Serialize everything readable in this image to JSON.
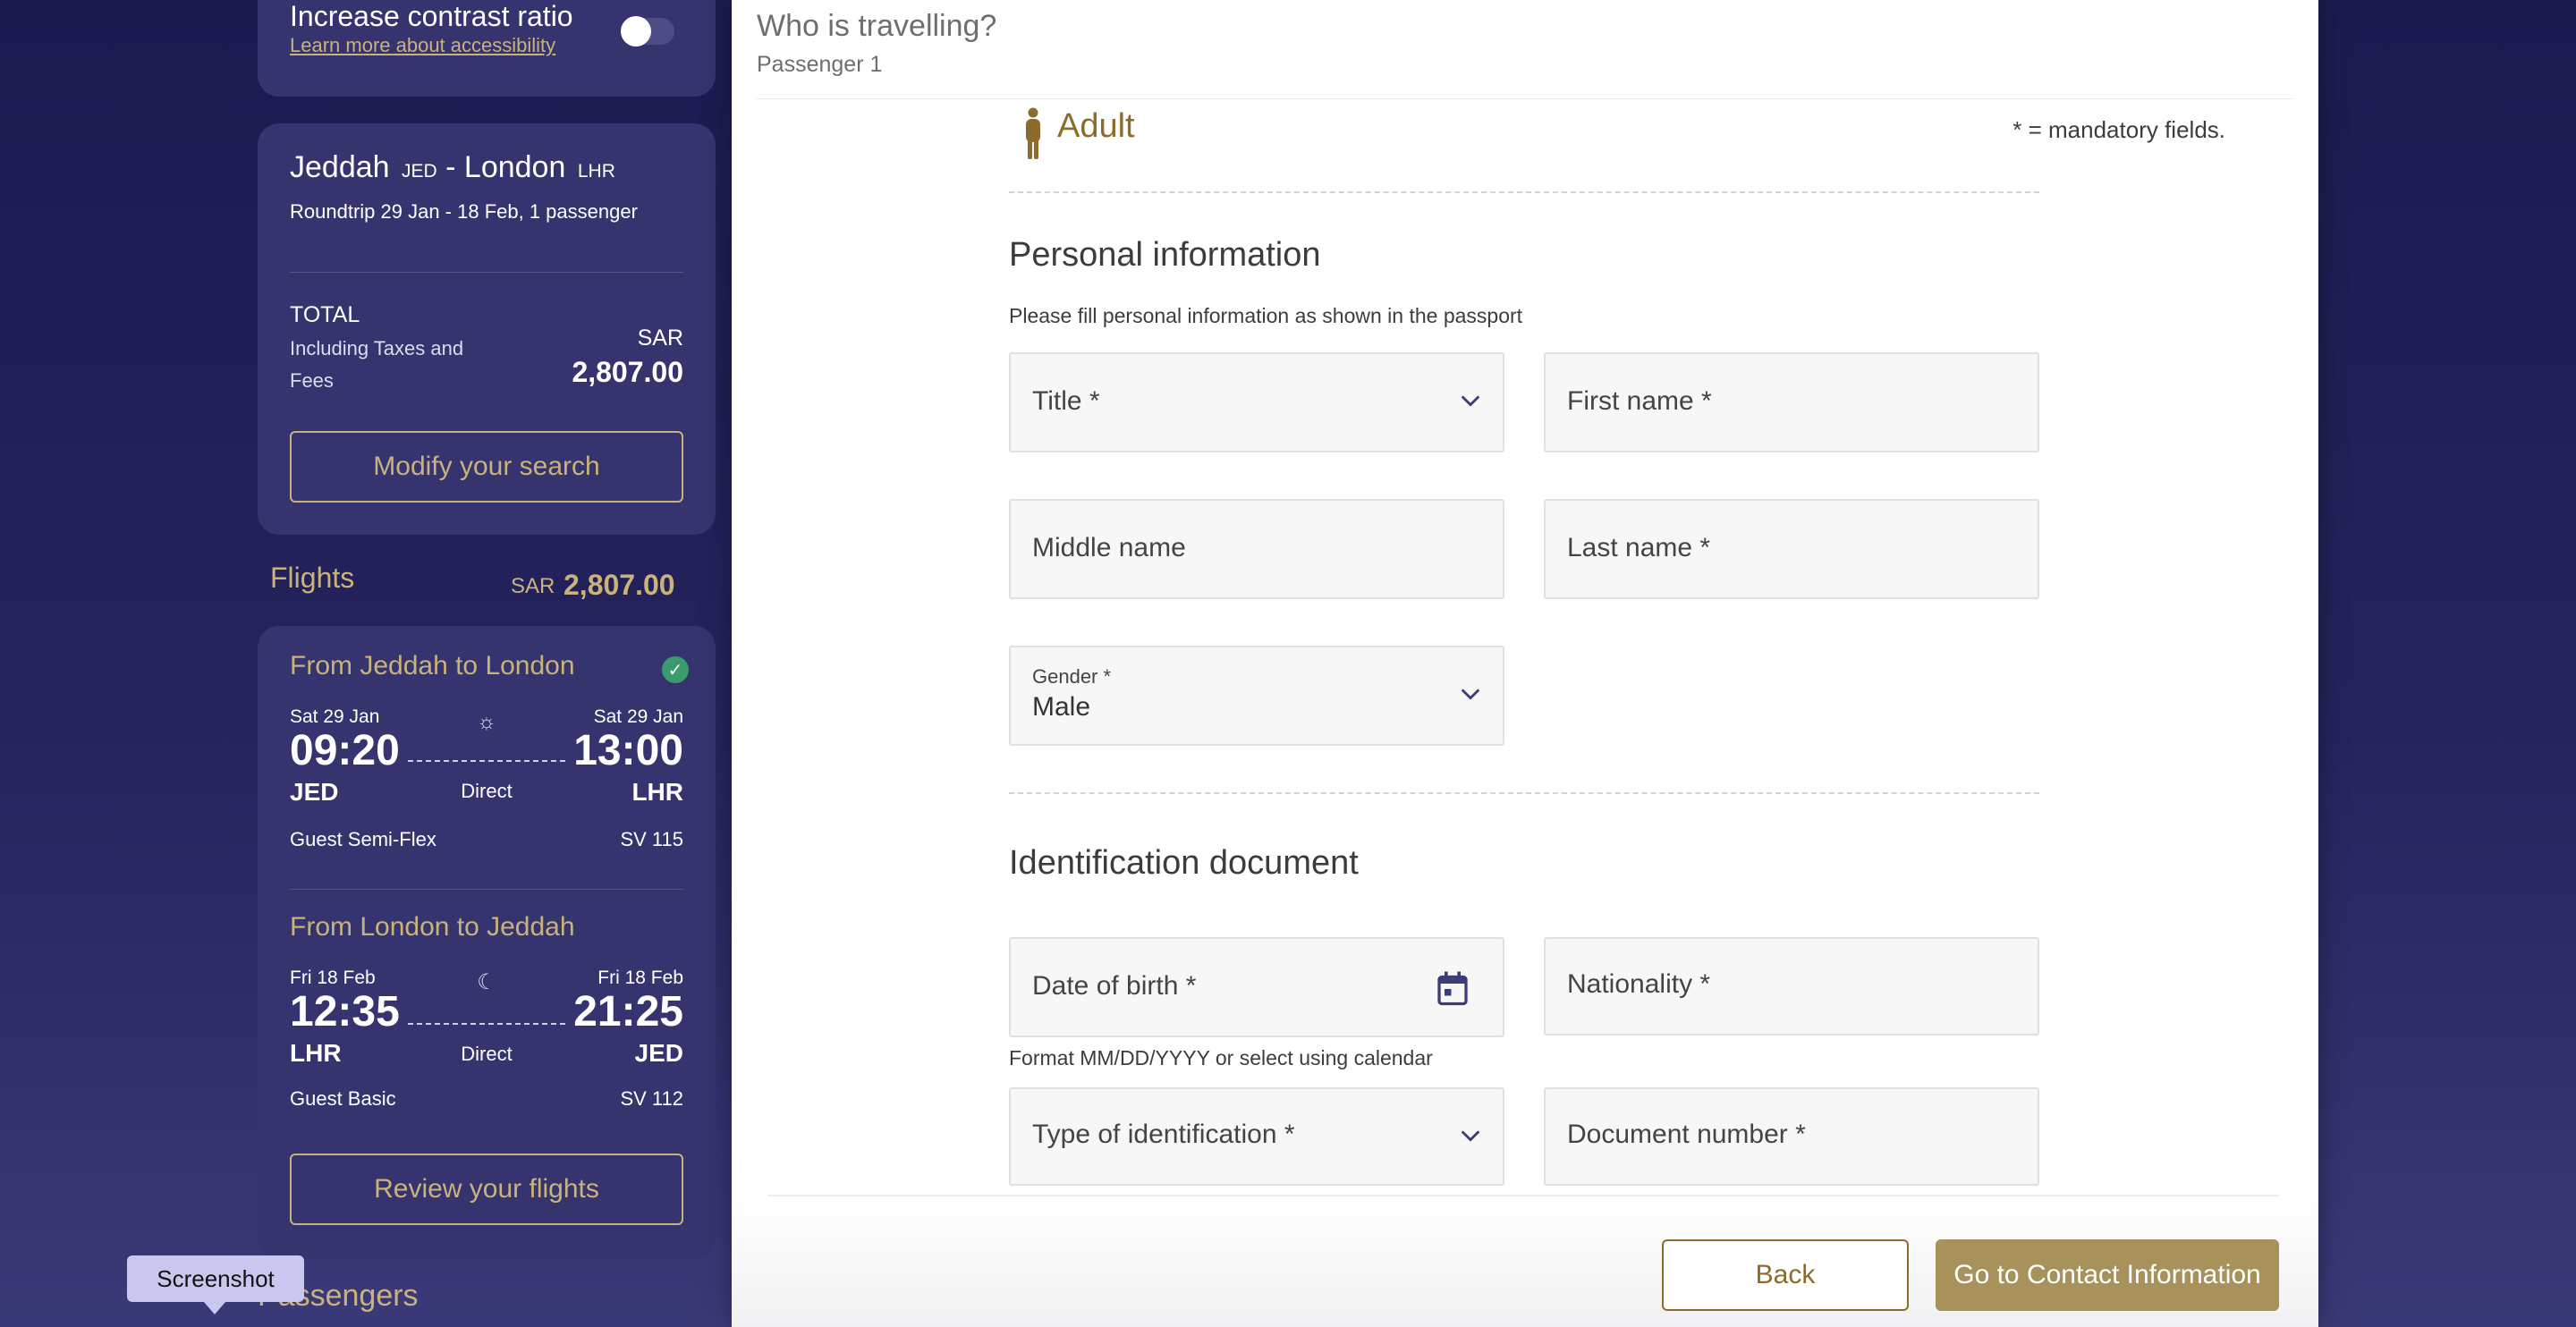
{
  "accessibility": {
    "title": "Increase contrast ratio",
    "link": "Learn more about accessibility",
    "toggle_on": false
  },
  "summary": {
    "origin_city": "Jeddah",
    "origin_code": "JED",
    "separator": "-",
    "destination_city": "London",
    "destination_code": "LHR",
    "trip_info": "Roundtrip 29 Jan - 18 Feb, 1 passenger",
    "total_label": "TOTAL",
    "total_note": "Including Taxes and Fees",
    "currency": "SAR",
    "total_amount": "2,807.00",
    "modify_button": "Modify your search"
  },
  "flights": {
    "heading": "Flights",
    "currency": "SAR",
    "price": "2,807.00",
    "legs": [
      {
        "title": "From Jeddah to London",
        "status_icon": "check-circle-icon",
        "dep_date": "Sat 29 Jan",
        "dep_time": "09:20",
        "dep_airport": "JED",
        "arr_date": "Sat 29 Jan",
        "arr_time": "13:00",
        "arr_airport": "LHR",
        "stops": "Direct",
        "time_icon": "sun-icon",
        "fare": "Guest Semi-Flex",
        "flight_no": "SV 115"
      },
      {
        "title": "From London to Jeddah",
        "dep_date": "Fri 18 Feb",
        "dep_time": "12:35",
        "dep_airport": "LHR",
        "arr_date": "Fri 18 Feb",
        "arr_time": "21:25",
        "arr_airport": "JED",
        "stops": "Direct",
        "time_icon": "sun-moon-icon",
        "fare": "Guest Basic",
        "flight_no": "SV 112"
      }
    ],
    "review_button": "Review your flights"
  },
  "passengers_heading": "Passengers",
  "tooltip": "Screenshot",
  "form": {
    "title": "Who is travelling?",
    "subtitle": "Passenger 1",
    "passenger_type": "Adult",
    "mandatory_note": "* = mandatory fields.",
    "personal": {
      "heading": "Personal information",
      "note": "Please fill personal information as shown in the passport",
      "title_label": "Title *",
      "first_name_label": "First name *",
      "middle_name_label": "Middle name",
      "last_name_label": "Last name *",
      "gender_label": "Gender *",
      "gender_value": "Male"
    },
    "identification": {
      "heading": "Identification document",
      "dob_label": "Date of birth *",
      "nationality_label": "Nationality *",
      "date_hint": "Format MM/DD/YYYY or select using calendar",
      "id_type_label": "Type of identification *",
      "document_number_label": "Document number *"
    },
    "back_button": "Back",
    "next_button": "Go to Contact Information"
  },
  "colors": {
    "accent_gold": "#c9b27b",
    "primary_button": "#a8925c",
    "sidebar_card": "#35346e",
    "background": "#1c1a4f"
  }
}
